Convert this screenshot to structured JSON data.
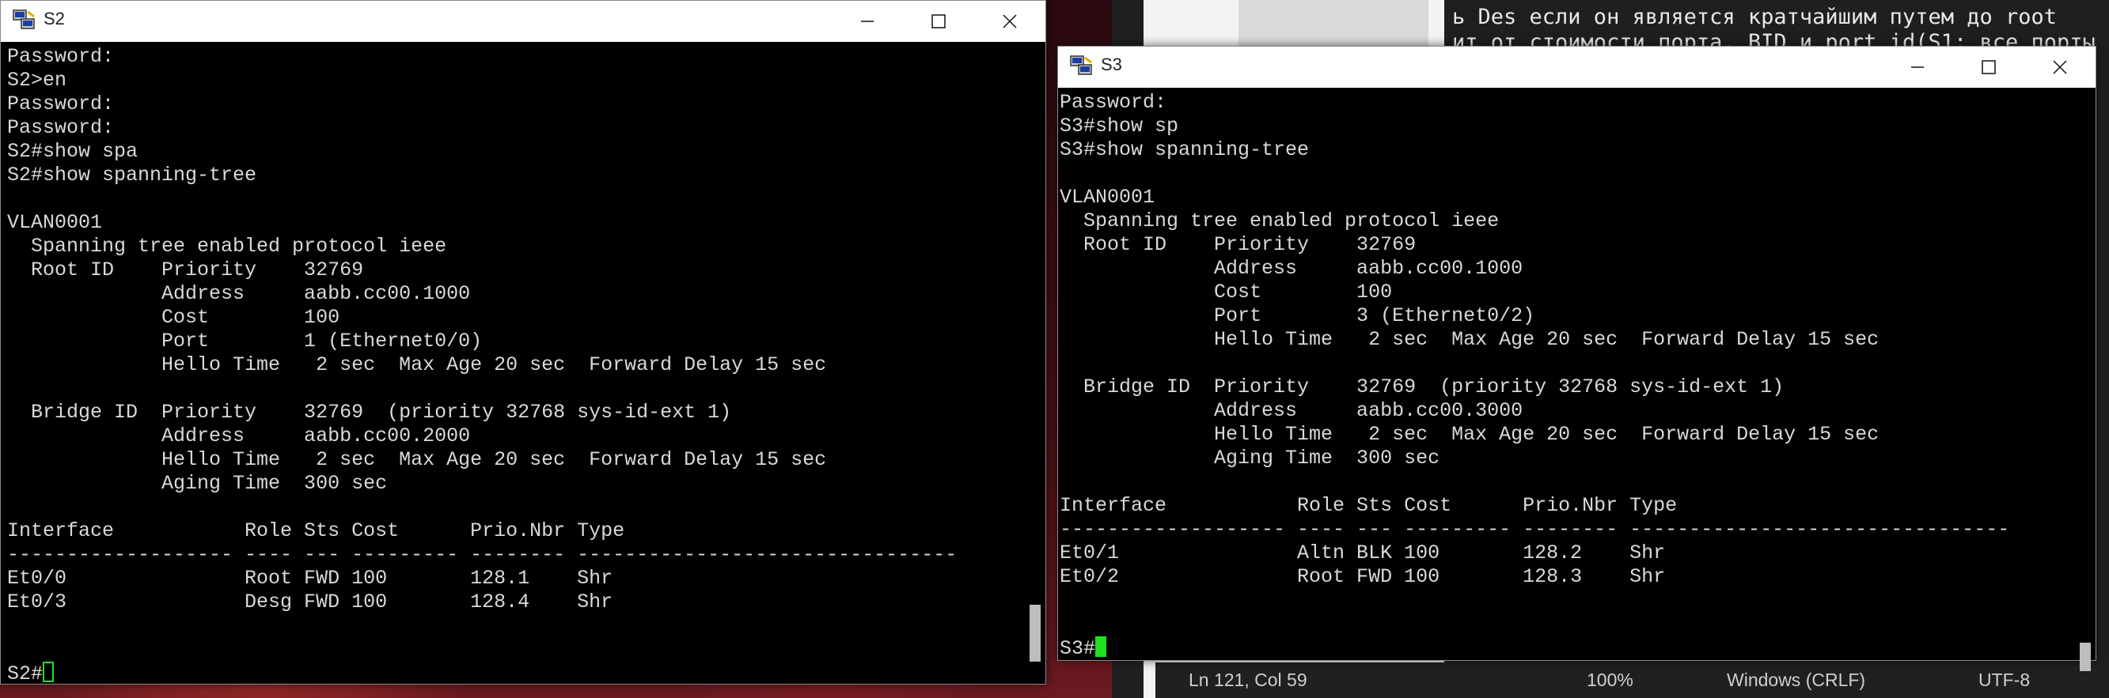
{
  "bg_editor": {
    "line1": "ь Des если он является кратчайшим путем до root",
    "line2": "ит от стоимости порта, BID и port id(S1; все порты",
    "statusbar": {
      "position": "Ln 121, Col 59",
      "zoom": "100%",
      "line_ending": "Windows (CRLF)",
      "encoding": "UTF-8"
    }
  },
  "s2": {
    "title": "S2",
    "icon": "putty-icon",
    "lines": [
      "Password:",
      "S2>en",
      "Password:",
      "Password:",
      "S2#show spa",
      "S2#show spanning-tree",
      "",
      "VLAN0001",
      "  Spanning tree enabled protocol ieee",
      "  Root ID    Priority    32769",
      "             Address     aabb.cc00.1000",
      "             Cost        100",
      "             Port        1 (Ethernet0/0)",
      "             Hello Time   2 sec  Max Age 20 sec  Forward Delay 15 sec",
      "",
      "  Bridge ID  Priority    32769  (priority 32768 sys-id-ext 1)",
      "             Address     aabb.cc00.2000",
      "             Hello Time   2 sec  Max Age 20 sec  Forward Delay 15 sec",
      "             Aging Time  300 sec",
      "",
      "Interface           Role Sts Cost      Prio.Nbr Type",
      "------------------- ---- --- --------- -------- --------------------------------",
      "Et0/0               Root FWD 100       128.1    Shr",
      "Et0/3               Desg FWD 100       128.4    Shr",
      "",
      ""
    ],
    "prompt": "S2#"
  },
  "s3": {
    "title": "S3",
    "icon": "putty-icon",
    "lines": [
      "Password:",
      "S3#show sp",
      "S3#show spanning-tree",
      "",
      "VLAN0001",
      "  Spanning tree enabled protocol ieee",
      "  Root ID    Priority    32769",
      "             Address     aabb.cc00.1000",
      "             Cost        100",
      "             Port        3 (Ethernet0/2)",
      "             Hello Time   2 sec  Max Age 20 sec  Forward Delay 15 sec",
      "",
      "  Bridge ID  Priority    32769  (priority 32768 sys-id-ext 1)",
      "             Address     aabb.cc00.3000",
      "             Hello Time   2 sec  Max Age 20 sec  Forward Delay 15 sec",
      "             Aging Time  300 sec",
      "",
      "Interface           Role Sts Cost      Prio.Nbr Type",
      "------------------- ---- --- --------- -------- --------------------------------",
      "Et0/1               Altn BLK 100       128.2    Shr",
      "Et0/2               Root FWD 100       128.3    Shr",
      "",
      ""
    ],
    "prompt": "S3#"
  },
  "colors": {
    "terminal_bg": "#000000",
    "terminal_fg": "#d9d9d9",
    "cursor": "#20e020"
  }
}
